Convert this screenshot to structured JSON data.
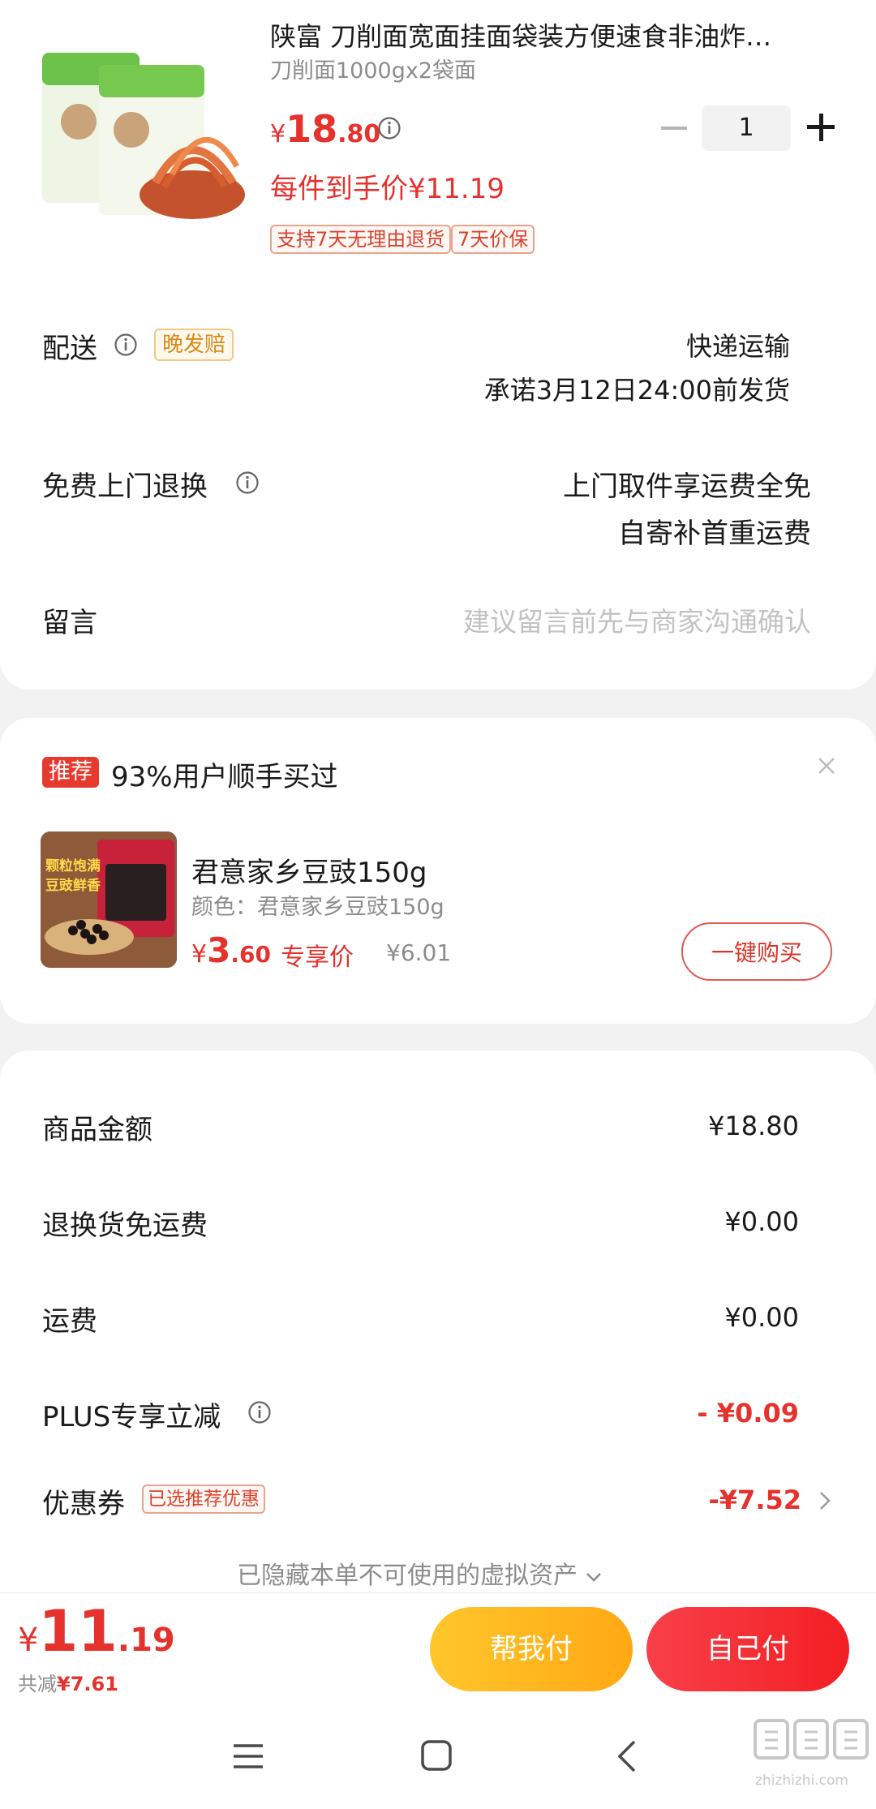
{
  "product": {
    "title": "陕富 刀削面宽面挂面袋装方便速食非油炸…",
    "spec": "刀削面1000gx2袋面",
    "price_symbol": "¥",
    "price_int": "18",
    "price_dec": ".80",
    "quantity": "1",
    "final_price_text": "每件到手价¥11.19",
    "tags": [
      "支持7天无理由退货",
      "7天价保"
    ]
  },
  "delivery": {
    "label": "配送",
    "badge": "晚发赔",
    "method": "快递运输",
    "promise": "承诺3月12日24:00前发货"
  },
  "free_return": {
    "label": "免费上门退换",
    "line1": "上门取件享运费全免",
    "line2": "自寄补首重运费"
  },
  "message": {
    "label": "留言",
    "placeholder": "建议留言前先与商家沟通确认"
  },
  "recommend": {
    "badge": "推荐",
    "title": "93%用户顺手买过",
    "item_name": "君意家乡豆豉150g",
    "item_spec": "颜色：君意家乡豆豉150g",
    "price_symbol": "¥",
    "price_int": "3",
    "price_dec": ".60",
    "exclusive_label": "专享价",
    "original_price": "¥6.01",
    "buy_button": "一键购买",
    "image_text_1": "颗粒饱满",
    "image_text_2": "豆豉鲜香"
  },
  "summary": {
    "rows": [
      {
        "label": "商品金额",
        "value": "¥18.80"
      },
      {
        "label": "退换货免运费",
        "value": "¥0.00"
      },
      {
        "label": "运费",
        "value": "¥0.00"
      },
      {
        "label": "PLUS专享立减",
        "value": "- ¥0.09"
      },
      {
        "label": "优惠券",
        "value": "-¥7.52",
        "badge": "已选推荐优惠"
      }
    ],
    "hidden_note": "已隐藏本单不可使用的虚拟资产"
  },
  "footer": {
    "total_symbol": "¥",
    "total_int": "11",
    "total_dec": ".19",
    "saved_label": "共减",
    "saved_value": "¥7.61",
    "help_pay": "帮我付",
    "self_pay": "自己付"
  },
  "watermark": "值 什么值得买",
  "watermark_url": "zhizhizhi.com",
  "colors": {
    "accent_red": "#e5322d",
    "help_pay_bg": "#ffb51f",
    "self_pay_bg": "#f23030"
  }
}
